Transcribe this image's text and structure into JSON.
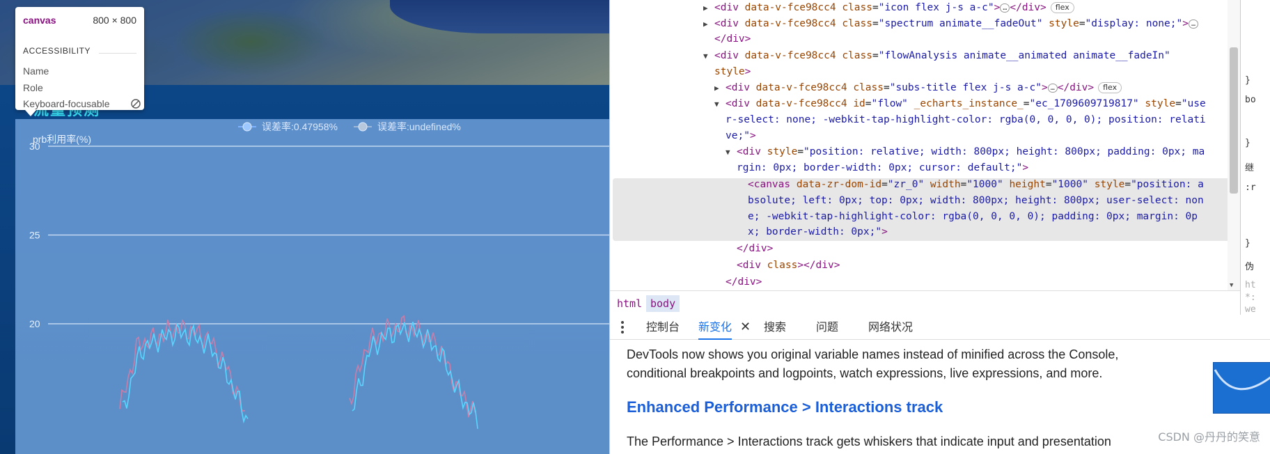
{
  "page": {
    "hud_title": "流量预测",
    "tooltip": {
      "tag": "canvas",
      "size": "800 × 800",
      "section": "ACCESSIBILITY",
      "rows": [
        "Name",
        "Role",
        "Keyboard-focusable"
      ]
    }
  },
  "chart_data": {
    "type": "line",
    "legend": [
      "误差率:0.47958%",
      "误差率:undefined%"
    ],
    "ylabel": "prb利用率(%)",
    "yticks": [
      "30",
      "25",
      "20"
    ],
    "ylim": [
      15,
      30
    ],
    "series": [
      {
        "color": "#c97ea9",
        "values": [
          15.2,
          18.8,
          19.2,
          19.7,
          19.6,
          19.1,
          17.5,
          14.8
        ]
      },
      {
        "color": "#58d6ff",
        "values": [
          15.0,
          18.5,
          19.1,
          19.5,
          19.3,
          18.6,
          16.8,
          14.5
        ]
      },
      {
        "color": "#c97ea9",
        "values": [
          15.6,
          18.9,
          19.6,
          19.9,
          19.5,
          18.7,
          16.4,
          14.9
        ]
      },
      {
        "color": "#58d6ff",
        "values": [
          15.1,
          18.6,
          19.4,
          19.7,
          19.3,
          18.2,
          16.0,
          14.6
        ]
      }
    ]
  },
  "devtools": {
    "lines": [
      {
        "t": "&lt;div data-v-fce98cc4 class=\"icon flex j-s a-c\"&gt;…&lt;/div&gt;"
      },
      {
        "t": "&lt;div data-v-fce98cc4 class=\"spectrum animate__fadeOut\" style=\"display: none;\"&gt;…"
      },
      {
        "t": "&lt;/div&gt;"
      },
      {
        "t": "&lt;div data-v-fce98cc4 class=\"flowAnalysis animate__animated animate__fadeIn\""
      },
      {
        "t": "style&gt;"
      },
      {
        "t": "&lt;div data-v-fce98cc4 class=\"subs-title flex j-s a-c\"&gt;…&lt;/div&gt;"
      },
      {
        "t": "&lt;div data-v-fce98cc4 id=\"flow\" _echarts_instance_=\"ec_1709609719817\" style=\"use"
      },
      {
        "t": "r-select: none; -webkit-tap-highlight-color: rgba(0, 0, 0, 0); position: relati"
      },
      {
        "t": "ve;\"&gt;"
      },
      {
        "t": "&lt;div style=\"position: relative; width: 800px; height: 800px; padding: 0px; ma"
      },
      {
        "t": "rgin: 0px; border-width: 0px; cursor: default;\"&gt;"
      },
      {
        "t": "&lt;canvas data-zr-dom-id=\"zr_0\" width=\"1000\" height=\"1000\" style=\"position: a"
      },
      {
        "t": "bsolute; left: 0px; top: 0px; width: 800px; height: 800px; user-select: non"
      },
      {
        "t": "e; -webkit-tap-highlight-color: rgba(0, 0, 0, 0); padding: 0px; margin: 0p"
      },
      {
        "t": "x; border-width: 0px;\"&gt;"
      },
      {
        "t": "&lt;/div&gt;"
      },
      {
        "t": "&lt;div class&gt;&lt;/div&gt;"
      },
      {
        "t": "&lt;/div&gt;"
      }
    ],
    "badge_flex": "flex",
    "dots": "…",
    "breadcrumb": [
      "html",
      "body"
    ],
    "drawer_tabs": [
      "控制台",
      "新变化",
      "搜索",
      "问题",
      "网络状况"
    ],
    "close_glyph": "✕",
    "whatsnew": {
      "p1": "DevTools now shows you original variable names instead of minified across the Console, conditional breakpoints and logpoints, watch expressions, live expressions, and more.",
      "heading": "Enhanced Performance > Interactions track",
      "p2": "The Performance > Interactions track gets whiskers that indicate input and presentation"
    },
    "styles_stub": [
      "}",
      "bo",
      "}",
      "继",
      ":r",
      "}",
      "伪",
      "ht",
      "*:",
      "we"
    ]
  },
  "watermark": "CSDN @丹丹的笑意",
  "colors": {
    "accent": "#1a73e8",
    "tag": "#881280",
    "attr_name": "#994500",
    "attr_value": "#1a1aa6"
  }
}
